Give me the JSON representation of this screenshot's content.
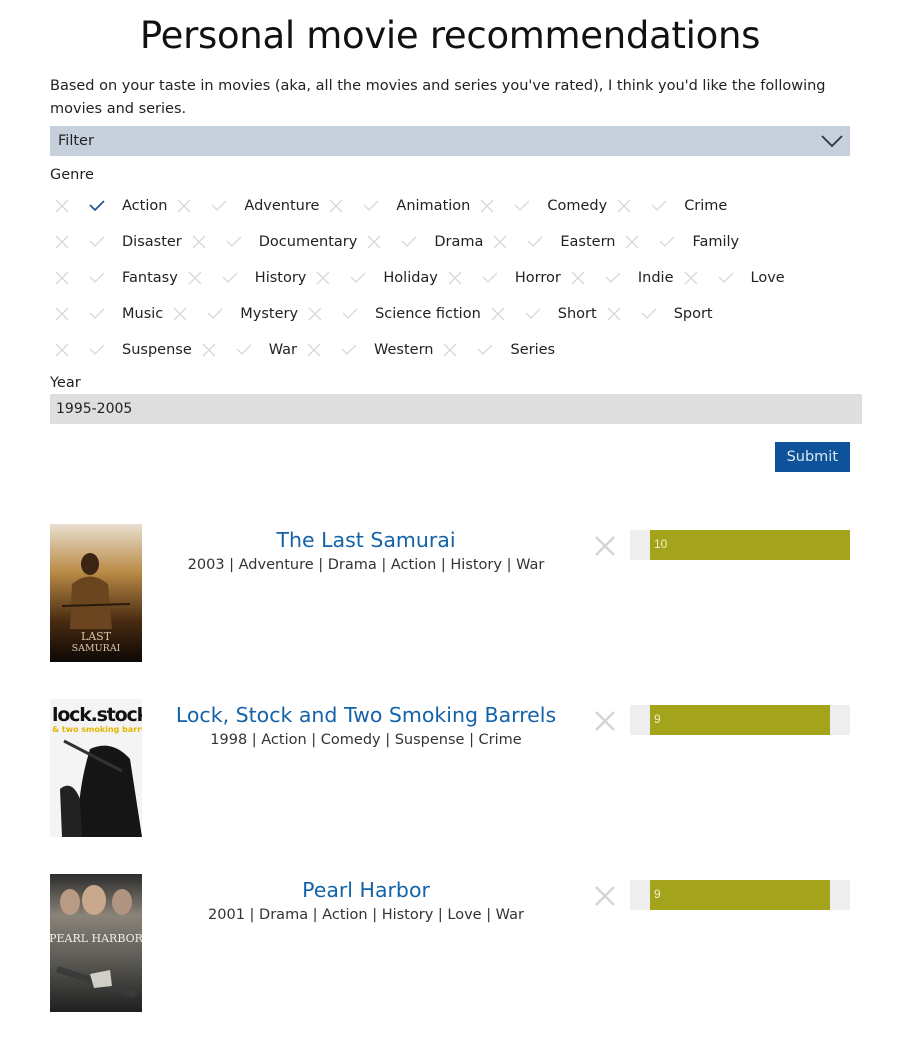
{
  "page": {
    "title": "Personal movie recommendations",
    "intro": "Based on your taste in movies (aka, all the movies and series you've rated), I think you'd like the following movies and series."
  },
  "filter": {
    "label": "Filter",
    "toggle_icon": "chevron-down-icon",
    "genre_label": "Genre",
    "genres": [
      {
        "label": "Action",
        "selected": true
      },
      {
        "label": "Adventure",
        "selected": false
      },
      {
        "label": "Animation",
        "selected": false
      },
      {
        "label": "Comedy",
        "selected": false
      },
      {
        "label": "Crime",
        "selected": false
      },
      {
        "label": "Disaster",
        "selected": false
      },
      {
        "label": "Documentary",
        "selected": false
      },
      {
        "label": "Drama",
        "selected": false
      },
      {
        "label": "Eastern",
        "selected": false
      },
      {
        "label": "Family",
        "selected": false
      },
      {
        "label": "Fantasy",
        "selected": false
      },
      {
        "label": "History",
        "selected": false
      },
      {
        "label": "Holiday",
        "selected": false
      },
      {
        "label": "Horror",
        "selected": false
      },
      {
        "label": "Indie",
        "selected": false
      },
      {
        "label": "Love",
        "selected": false
      },
      {
        "label": "Music",
        "selected": false
      },
      {
        "label": "Mystery",
        "selected": false
      },
      {
        "label": "Science fiction",
        "selected": false
      },
      {
        "label": "Short",
        "selected": false
      },
      {
        "label": "Sport",
        "selected": false
      },
      {
        "label": "Suspense",
        "selected": false
      },
      {
        "label": "War",
        "selected": false
      },
      {
        "label": "Western",
        "selected": false
      },
      {
        "label": "Series",
        "selected": false
      }
    ],
    "year_label": "Year",
    "year_value": "1995-2005",
    "submit_label": "Submit"
  },
  "movies": [
    {
      "title": "The Last Samurai",
      "meta": "2003 | Adventure | Drama | Action | History | War",
      "rating": 10,
      "rating_max": 10,
      "poster": "The Last Samurai poster"
    },
    {
      "title": "Lock, Stock and Two Smoking Barrels",
      "meta": "1998 | Action | Comedy | Suspense | Crime",
      "rating": 9,
      "rating_max": 10,
      "poster": "Lock, Stock and Two Smoking Barrels poster"
    },
    {
      "title": "Pearl Harbor",
      "meta": "2001 | Drama | Action | History | Love | War",
      "rating": 9,
      "rating_max": 10,
      "poster": "Pearl Harbor poster"
    }
  ],
  "colors": {
    "filter_bar": "#c6d0dc",
    "selected_check": "#1f5c99",
    "unselected_icon": "#d8d8d8",
    "title_link": "#1462a8",
    "submit": "#0e5399",
    "rating_fill": "#a3a41b",
    "rating_track": "#eeeeee"
  }
}
